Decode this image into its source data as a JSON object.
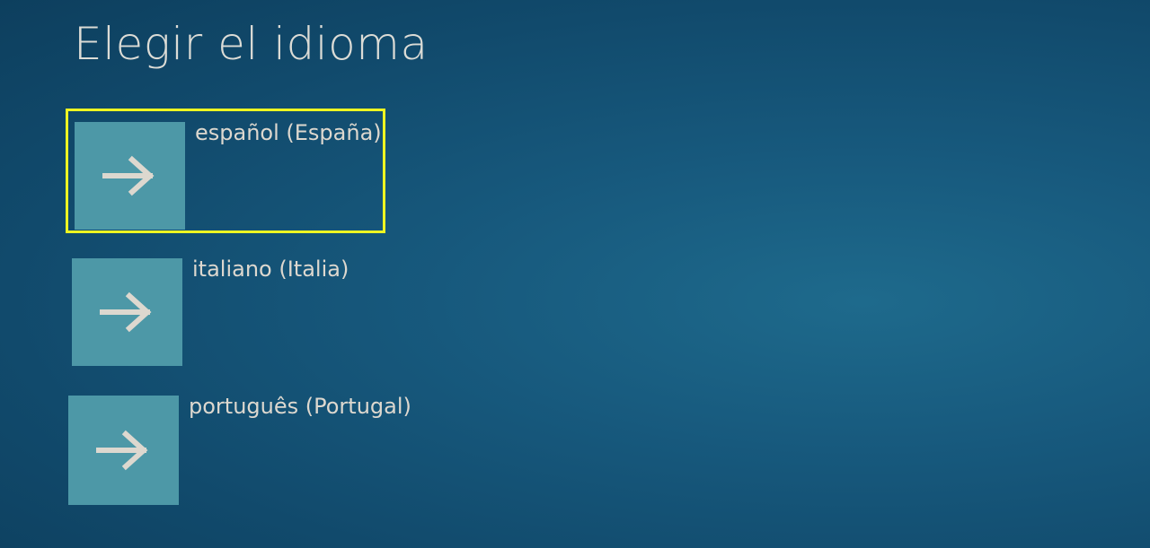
{
  "page": {
    "title": "Elegir el idioma"
  },
  "languages": [
    {
      "label": "español (España)",
      "icon": "arrow-right-icon",
      "selected": true
    },
    {
      "label": "italiano (Italia)",
      "icon": "arrow-right-icon",
      "selected": false
    },
    {
      "label": "português (Portugal)",
      "icon": "arrow-right-icon",
      "selected": false
    }
  ],
  "colors": {
    "background": "#114a6c",
    "tile": "#4d98a7",
    "highlight": "#eef522",
    "text": "#ddd8cf"
  }
}
